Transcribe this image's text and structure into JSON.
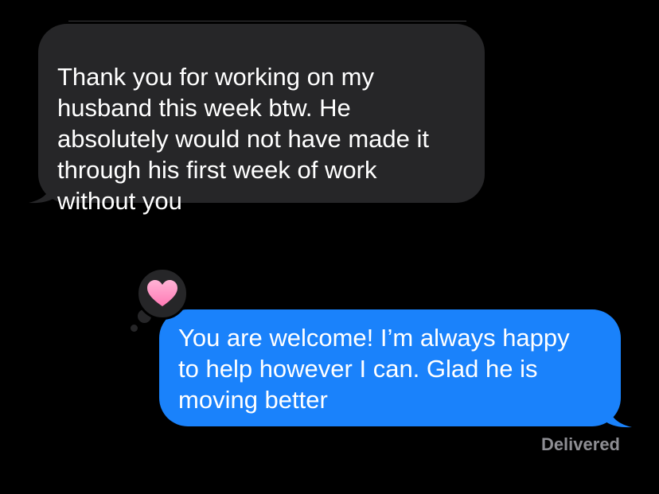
{
  "thread": {
    "incoming_message": {
      "text": "Thank you for working on my\nhusband this week btw. He\nabsolutely would not have made it\nthrough his first week of work\nwithout you",
      "bubble_color": "#262628"
    },
    "outgoing_message": {
      "text": "You are welcome! I’m always happy\nto help however I can. Glad he is\nmoving better",
      "bubble_color": "#1a82fb",
      "tapback": {
        "icon": "heart-icon",
        "color": "#ff8fc4"
      },
      "status": "Delivered"
    }
  }
}
